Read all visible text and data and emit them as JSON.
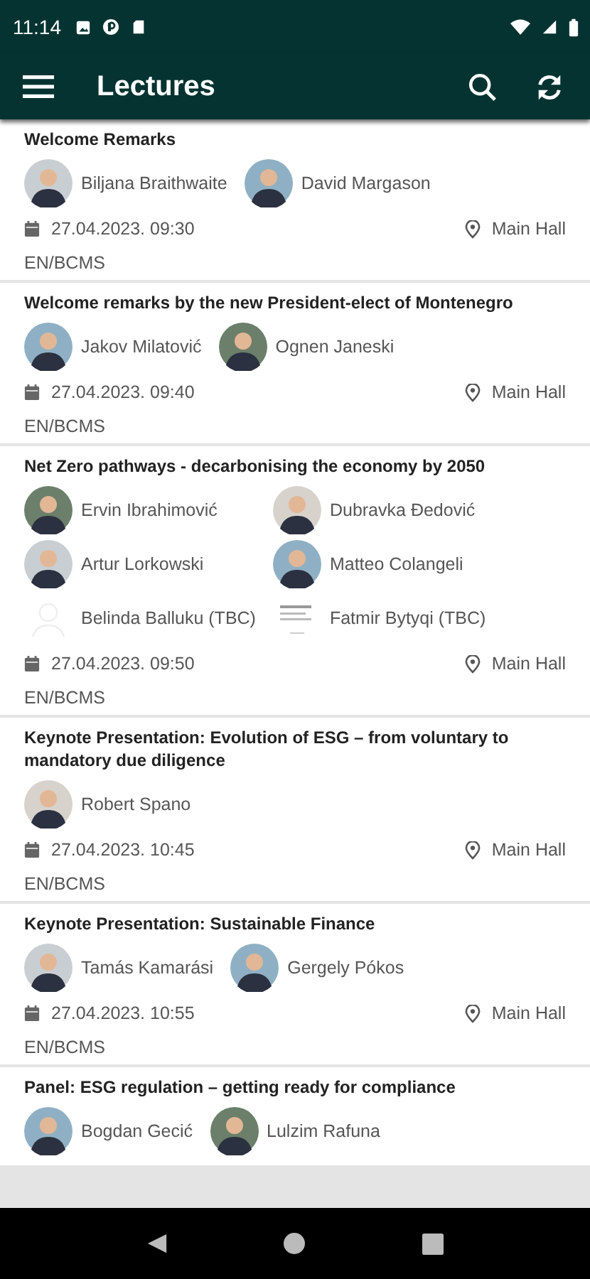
{
  "status_bar": {
    "time": "11:14"
  },
  "app_bar": {
    "title": "Lectures"
  },
  "lectures": [
    {
      "title": "Welcome Remarks",
      "speakers": [
        {
          "name": "Biljana Braithwaite",
          "kind": "photo"
        },
        {
          "name": "David Margason",
          "kind": "photo"
        }
      ],
      "datetime": "27.04.2023. 09:30",
      "location": "Main Hall",
      "languages": "EN/BCMS"
    },
    {
      "title": "Welcome remarks by the new President-elect of Montenegro",
      "speakers": [
        {
          "name": "Jakov Milatović",
          "kind": "photo"
        },
        {
          "name": "Ognen  Janeski",
          "kind": "photo"
        }
      ],
      "datetime": "27.04.2023. 09:40",
      "location": "Main Hall",
      "languages": "EN/BCMS"
    },
    {
      "title": "Net Zero pathways - decarbonising the economy by 2050",
      "speakers": [
        {
          "name": "Ervin Ibrahimović",
          "kind": "photo"
        },
        {
          "name": "Dubravka  Đedović",
          "kind": "photo"
        },
        {
          "name": "Artur Lorkowski",
          "kind": "photo"
        },
        {
          "name": "Matteo Colangeli",
          "kind": "photo"
        },
        {
          "name": "Belinda Balluku (TBC)",
          "kind": "blank"
        },
        {
          "name": "Fatmir Bytyqi (TBC)",
          "kind": "logo"
        }
      ],
      "datetime": "27.04.2023. 09:50",
      "location": "Main Hall",
      "languages": "EN/BCMS"
    },
    {
      "title": "Keynote Presentation: Evolution of ESG – from voluntary to mandatory due diligence",
      "speakers": [
        {
          "name": "Robert Spano",
          "kind": "photo"
        }
      ],
      "datetime": "27.04.2023. 10:45",
      "location": "Main Hall",
      "languages": "EN/BCMS"
    },
    {
      "title": "Keynote Presentation: Sustainable Finance",
      "speakers": [
        {
          "name": "Tamás Kamarási",
          "kind": "photo"
        },
        {
          "name": "Gergely Pókos",
          "kind": "photo"
        }
      ],
      "datetime": "27.04.2023. 10:55",
      "location": "Main Hall",
      "languages": "EN/BCMS"
    },
    {
      "title": "Panel: ESG regulation – getting ready for compliance",
      "speakers": [
        {
          "name": "Bogdan Gecić",
          "kind": "photo"
        },
        {
          "name": "Lulzim Rafuna",
          "kind": "photo"
        }
      ]
    }
  ]
}
